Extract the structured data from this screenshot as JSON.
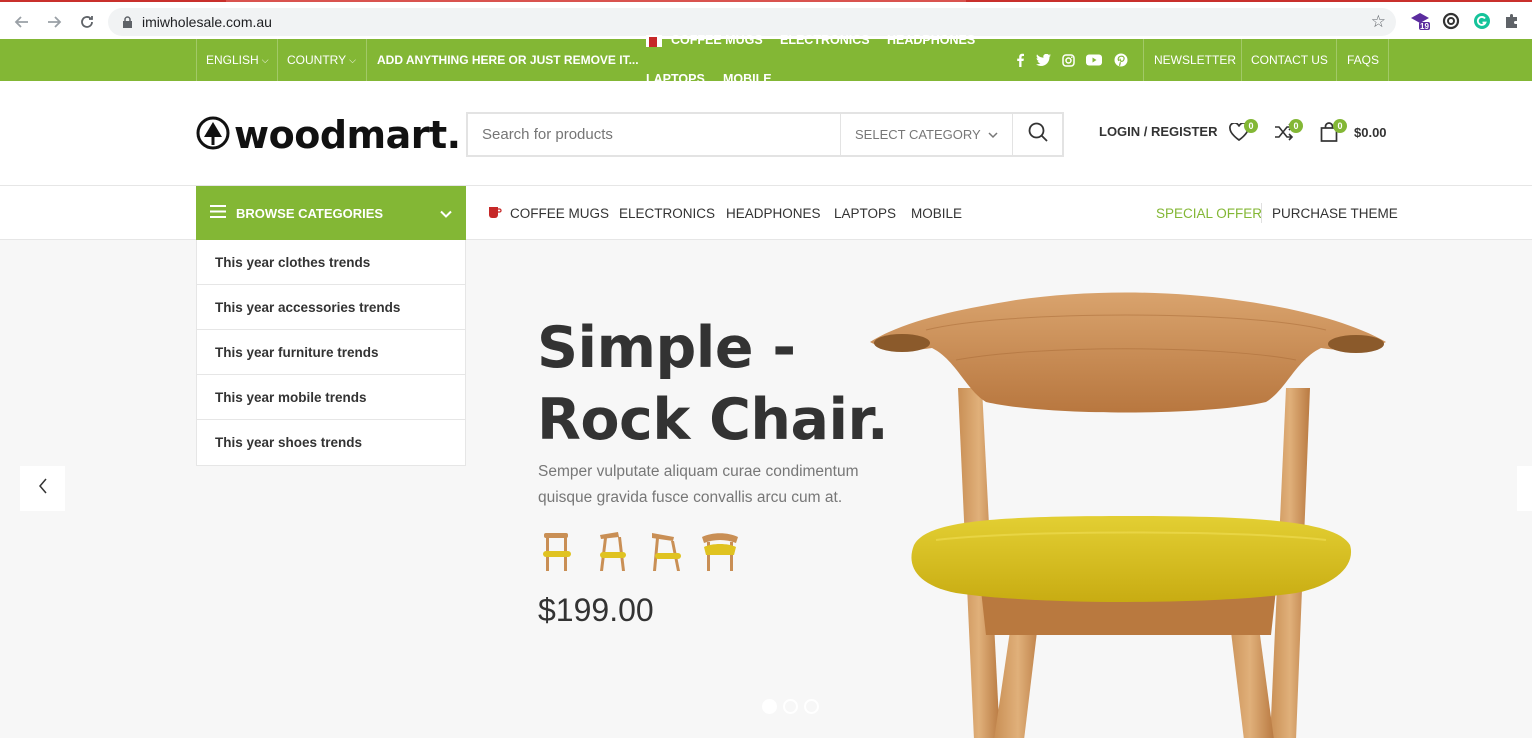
{
  "browser": {
    "url": "imiwholesale.com.au",
    "extension_badge": "19"
  },
  "topbar": {
    "language": "ENGLISH",
    "country": "COUNTRY",
    "promo_text": "ADD ANYTHING HERE OR JUST REMOVE IT...",
    "overflow_menu": [
      "COFFEE MUGS",
      "ELECTRONICS",
      "HEADPHONES",
      "LAPTOPS",
      "MOBILE"
    ],
    "links": [
      "NEWSLETTER",
      "CONTACT US",
      "FAQS"
    ],
    "social_icons": [
      "facebook-icon",
      "twitter-icon",
      "instagram-icon",
      "youtube-icon",
      "pinterest-icon"
    ]
  },
  "header": {
    "logo_text": "woodmart.",
    "search_placeholder": "Search for products",
    "category_select": "SELECT CATEGORY",
    "login_label": "LOGIN / REGISTER",
    "wishlist_count": "0",
    "compare_count": "0",
    "cart_count": "0",
    "cart_total": "$0.00"
  },
  "mainnav": {
    "browse_label": "BROWSE CATEGORIES",
    "links": [
      "COFFEE MUGS",
      "ELECTRONICS",
      "HEADPHONES",
      "LAPTOPS",
      "MOBILE"
    ],
    "special_offer": "SPECIAL OFFER",
    "purchase_theme": "PURCHASE THEME"
  },
  "categories": [
    "This year clothes trends",
    "This year accessories trends",
    "This year furniture trends",
    "This year mobile trends",
    "This year shoes trends"
  ],
  "hero": {
    "title_line1": "Simple -",
    "title_line2": "Rock Chair.",
    "description": "Semper vulputate aliquam curae condimentum quisque gravida fusce convallis arcu cum at.",
    "price": "$199.00",
    "slide_count": 3,
    "active_slide": 1
  },
  "colors": {
    "accent": "#83b735",
    "text": "#333333",
    "hero_bg": "#f7f7f7",
    "chair_wood": "#c98f55",
    "chair_seat": "#d9c11f"
  }
}
